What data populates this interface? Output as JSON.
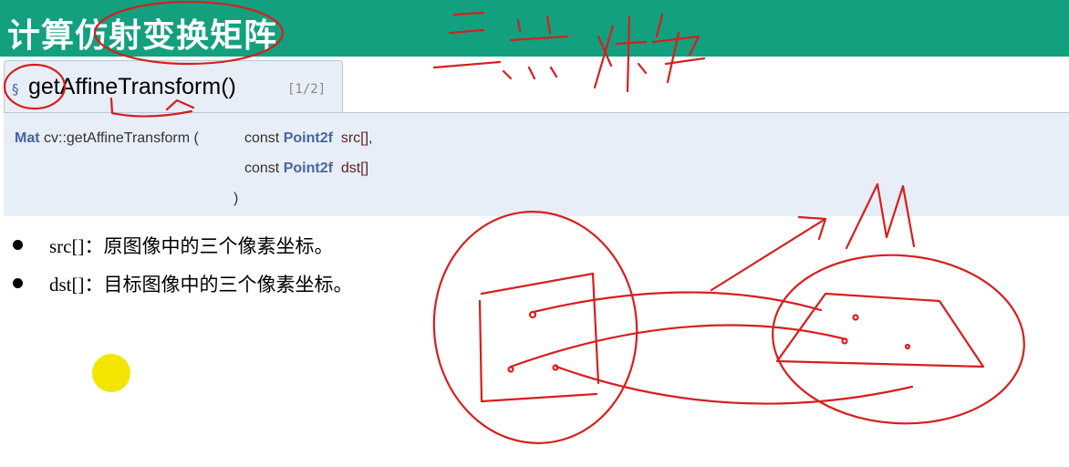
{
  "header": {
    "title": "计算仿射变换矩阵"
  },
  "doc_tab": {
    "section_symbol": "§",
    "function_name": "getAffineTransform()",
    "page_indicator": "[1/2]"
  },
  "signature": {
    "return_type": "Mat",
    "qualified_name": "cv::getAffineTransform",
    "open_paren": "(",
    "line1_const": "const",
    "line1_type": "Point2f",
    "line1_param": "src[],",
    "line2_const": "const",
    "line2_type": "Point2f",
    "line2_param": "dst[]",
    "close_paren": ")"
  },
  "bullets": [
    {
      "text": "src[]：原图像中的三个像素坐标。"
    },
    {
      "text": "dst[]：目标图像中的三个像素坐标。"
    }
  ],
  "colors": {
    "header_bg": "#12a07f",
    "doc_bg": "#e8eef7",
    "keyword": "#4665a2",
    "annotation_ink": "#d81e1e",
    "pointer": "#f2e600"
  }
}
